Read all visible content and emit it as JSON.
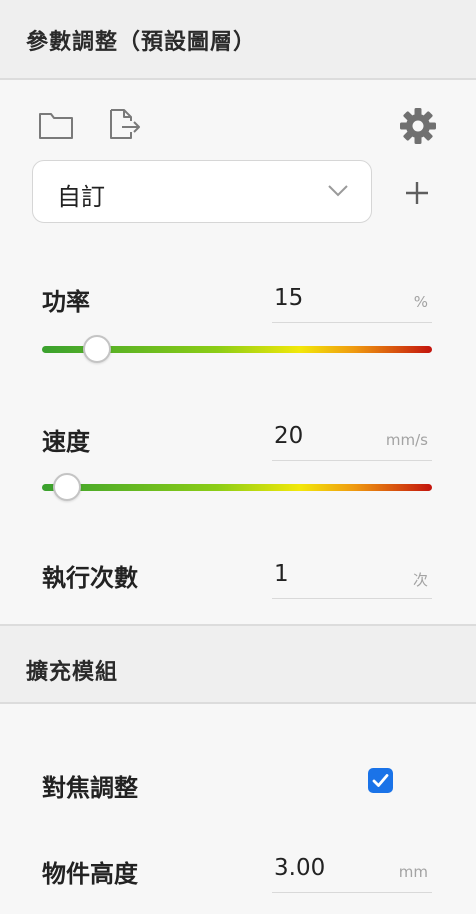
{
  "panel": {
    "title": "參數調整（預設圖層）"
  },
  "toolbar": {
    "open_icon": "folder-icon",
    "export_icon": "file-export-icon",
    "settings_icon": "gear-icon"
  },
  "preset": {
    "selected": "自訂",
    "add_icon": "plus-icon"
  },
  "power": {
    "label": "功率",
    "value": "15",
    "unit": "%",
    "slider_fraction": 0.14
  },
  "speed": {
    "label": "速度",
    "value": "20",
    "unit": "mm/s",
    "slider_fraction": 0.065
  },
  "passes": {
    "label": "執行次數",
    "value": "1",
    "unit": "次"
  },
  "modules": {
    "title": "擴充模組",
    "focus": {
      "label": "對焦調整",
      "checked": true
    },
    "object_height": {
      "label": "物件高度",
      "value": "3.00",
      "unit": "mm"
    }
  },
  "colors": {
    "accent": "#1a73e8"
  }
}
